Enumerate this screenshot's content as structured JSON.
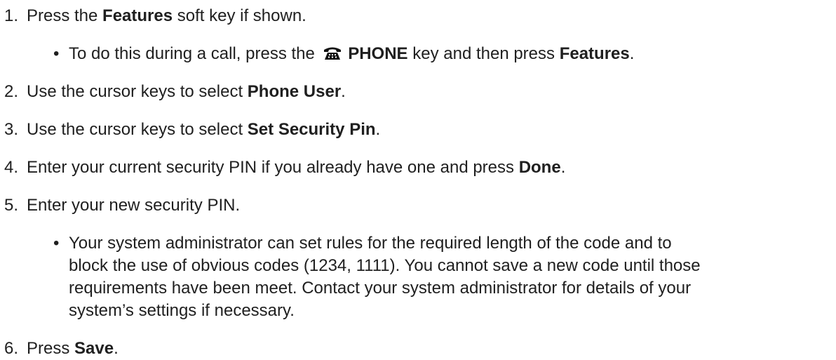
{
  "steps": [
    {
      "num": "1.",
      "pre": "Press the ",
      "bold": "Features",
      "post": " soft key if shown."
    },
    {
      "num": "2.",
      "pre": "Use the cursor keys to select ",
      "bold": "Phone User",
      "post": "."
    },
    {
      "num": "3.",
      "pre": "Use the cursor keys to select ",
      "bold": "Set Security Pin",
      "post": "."
    },
    {
      "num": "4.",
      "pre": "Enter your current security PIN if you already have one and press ",
      "bold": "Done",
      "post": "."
    },
    {
      "num": "5.",
      "text": "Enter your new security PIN."
    },
    {
      "num": "6.",
      "pre": "Press ",
      "bold": "Save",
      "post": "."
    }
  ],
  "sub1": {
    "bullet": "•",
    "pre": "To do this during a call, press the ",
    "icon": "phone-icon",
    "bold1": "PHONE",
    "mid": " key and then press ",
    "bold2": "Features",
    "post": "."
  },
  "sub5": {
    "bullet": "•",
    "lines": [
      "Your system administrator can set rules for the required length of the code and to",
      "block the use of obvious codes (1234, 1111). You cannot save a new code until those",
      "requirements have been meet. Contact your system administrator for details of your",
      "system’s settings if necessary."
    ]
  }
}
